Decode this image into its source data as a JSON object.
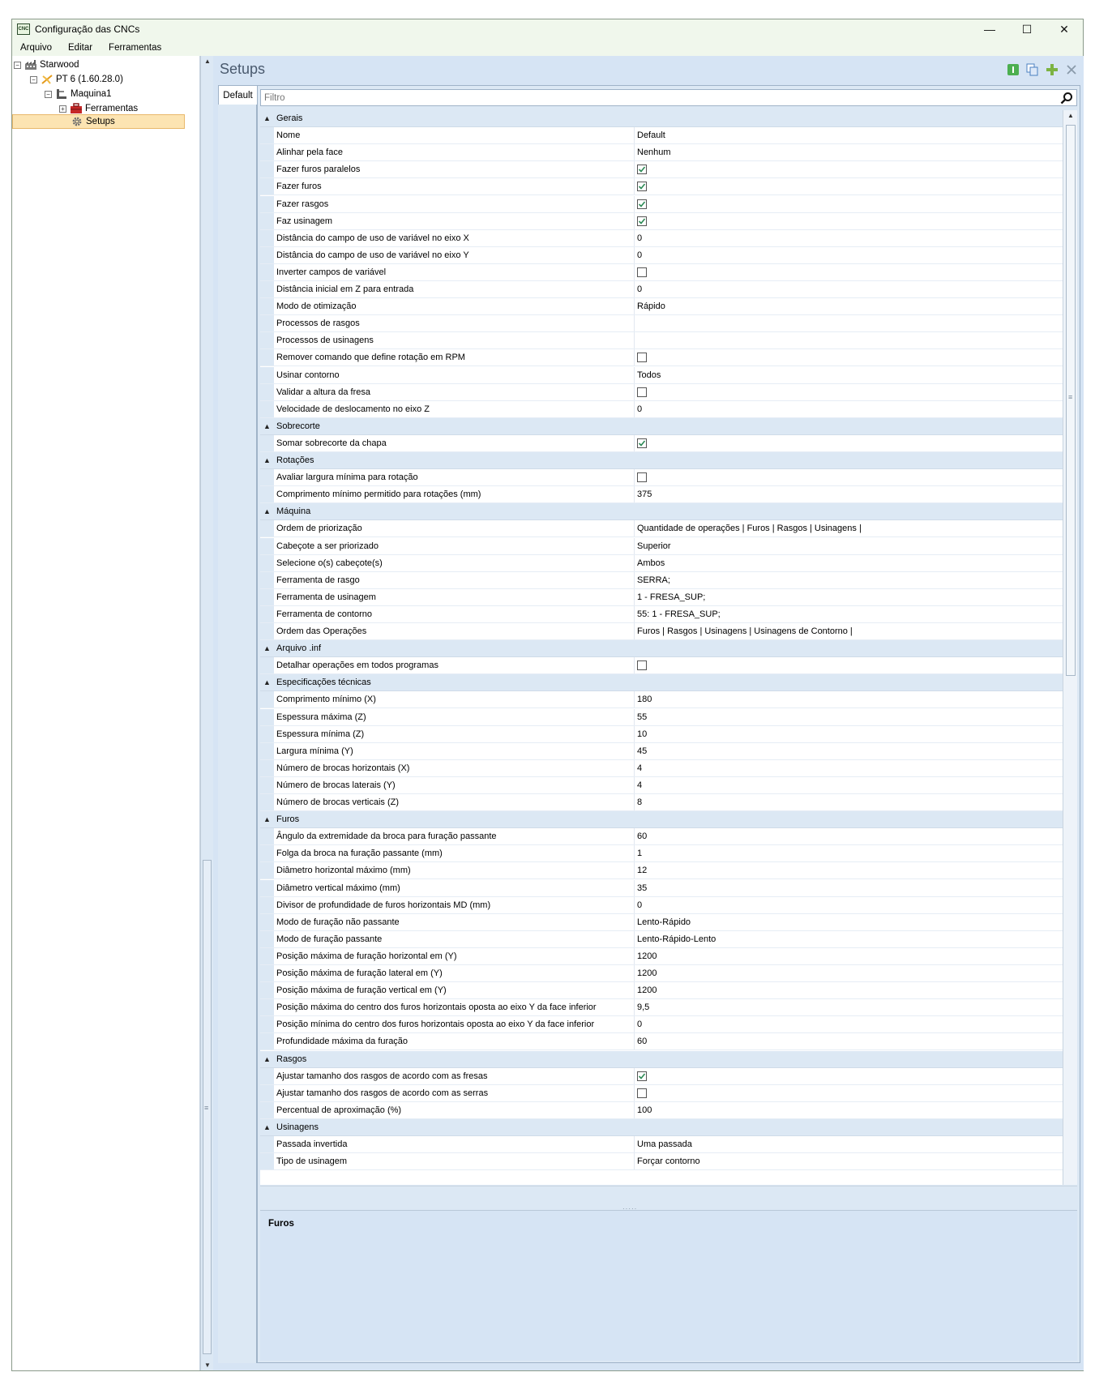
{
  "window": {
    "title": "Configuração das CNCs",
    "icon_label": "CNC",
    "controls": {
      "minimize": "—",
      "maximize": "☐",
      "close": "✕"
    }
  },
  "menu": [
    "Arquivo",
    "Editar",
    "Ferramentas"
  ],
  "tree": {
    "items": [
      {
        "label": "Starwood",
        "icon": "factory-icon"
      },
      {
        "label": "PT 6 (1.60.28.0)",
        "icon": "plugin-icon"
      },
      {
        "label": "Maquina1",
        "icon": "machine-icon"
      },
      {
        "label": "Ferramentas",
        "icon": "toolbox-icon"
      },
      {
        "label": "Setups",
        "icon": "gear-icon"
      }
    ]
  },
  "panel": {
    "title": "Setups",
    "tab": "Default",
    "filter_placeholder": "Filtro",
    "description_title": "Furos",
    "colors": {
      "accent": "#dce8f4",
      "selection": "#fce4b2",
      "check": "#2e8b57"
    }
  },
  "groups": [
    {
      "name": "Gerais",
      "rows": [
        {
          "label": "Nome",
          "value": "Default"
        },
        {
          "label": "Alinhar pela face",
          "value": "Nenhum"
        },
        {
          "label": "Fazer furos paralelos",
          "check": true
        },
        {
          "label": "Fazer furos",
          "check": true
        },
        {
          "label": "Fazer rasgos",
          "check": true
        },
        {
          "label": "Faz usinagem",
          "check": true
        },
        {
          "label": "Distância do campo de uso de variável no eixo X",
          "value": "0"
        },
        {
          "label": "Distância do campo de uso de variável no eixo Y",
          "value": "0"
        },
        {
          "label": "Inverter campos de variável",
          "check": false
        },
        {
          "label": "Distância inicial em Z para entrada",
          "value": "0"
        },
        {
          "label": "Modo de otimização",
          "value": "Rápido"
        },
        {
          "label": "Processos de rasgos",
          "value": ""
        },
        {
          "label": "Processos de usinagens",
          "value": ""
        },
        {
          "label": "Remover comando que define rotação em RPM",
          "check": false
        },
        {
          "label": "Usinar contorno",
          "value": "Todos"
        },
        {
          "label": "Validar a altura da fresa",
          "check": false
        },
        {
          "label": "Velocidade de deslocamento no eixo Z",
          "value": "0"
        }
      ]
    },
    {
      "name": "Sobrecorte",
      "rows": [
        {
          "label": "Somar sobrecorte da chapa",
          "check": true
        }
      ]
    },
    {
      "name": "Rotações",
      "rows": [
        {
          "label": "Avaliar largura mínima para rotação",
          "check": false
        },
        {
          "label": "Comprimento mínimo permitido para rotações (mm)",
          "value": "375"
        }
      ]
    },
    {
      "name": "Máquina",
      "rows": [
        {
          "label": "Ordem de priorização",
          "value": "Quantidade de operações | Furos | Rasgos | Usinagens |"
        },
        {
          "label": "Cabeçote a ser priorizado",
          "value": "Superior"
        },
        {
          "label": "Selecione o(s) cabeçote(s)",
          "value": "Ambos"
        },
        {
          "label": "Ferramenta de rasgo",
          "value": "SERRA;"
        },
        {
          "label": "Ferramenta de usinagem",
          "value": "1 - FRESA_SUP;"
        },
        {
          "label": "Ferramenta de contorno",
          "value": "55: 1 - FRESA_SUP;"
        },
        {
          "label": "Ordem das Operações",
          "value": "Furos | Rasgos | Usinagens | Usinagens de Contorno |"
        }
      ]
    },
    {
      "name": "Arquivo .inf",
      "rows": [
        {
          "label": "Detalhar operações em todos programas",
          "check": false
        }
      ]
    },
    {
      "name": "Especificações técnicas",
      "rows": [
        {
          "label": "Comprimento mínimo (X)",
          "value": "180"
        },
        {
          "label": "Espessura máxima (Z)",
          "value": "55"
        },
        {
          "label": "Espessura mínima (Z)",
          "value": "10"
        },
        {
          "label": "Largura mínima (Y)",
          "value": "45"
        },
        {
          "label": "Número de brocas horizontais (X)",
          "value": "4"
        },
        {
          "label": "Número de brocas laterais (Y)",
          "value": "4"
        },
        {
          "label": "Número de brocas verticais (Z)",
          "value": "8"
        }
      ]
    },
    {
      "name": "Furos",
      "rows": [
        {
          "label": "Ângulo da extremidade da broca para furação passante",
          "value": "60"
        },
        {
          "label": "Folga da broca na furação passante (mm)",
          "value": "1"
        },
        {
          "label": "Diâmetro horizontal máximo (mm)",
          "value": "12"
        },
        {
          "label": "Diâmetro vertical máximo (mm)",
          "value": "35"
        },
        {
          "label": "Divisor de profundidade de furos horizontais MD (mm)",
          "value": "0"
        },
        {
          "label": "Modo de furação não passante",
          "value": "Lento-Rápido"
        },
        {
          "label": "Modo de furação passante",
          "value": "Lento-Rápido-Lento"
        },
        {
          "label": "Posição máxima de furação horizontal em (Y)",
          "value": "1200"
        },
        {
          "label": "Posição máxima de furação lateral em (Y)",
          "value": "1200"
        },
        {
          "label": "Posição máxima de furação vertical em (Y)",
          "value": "1200"
        },
        {
          "label": "Posição máxima do centro dos furos horizontais oposta ao eixo Y da face inferior",
          "value": "9,5"
        },
        {
          "label": "Posição mínima do centro dos furos horizontais oposta ao eixo Y da face inferior",
          "value": "0"
        },
        {
          "label": "Profundidade máxima da furação",
          "value": "60"
        }
      ]
    },
    {
      "name": "Rasgos",
      "rows": [
        {
          "label": "Ajustar tamanho dos rasgos de acordo com as fresas",
          "check": true
        },
        {
          "label": "Ajustar tamanho dos rasgos de acordo com as serras",
          "check": false
        },
        {
          "label": "Percentual de aproximação (%)",
          "value": "100"
        }
      ]
    },
    {
      "name": "Usinagens",
      "rows": [
        {
          "label": "Passada invertida",
          "value": "Uma passada"
        },
        {
          "label": "Tipo de usinagem",
          "value": "Forçar contorno"
        }
      ]
    }
  ]
}
